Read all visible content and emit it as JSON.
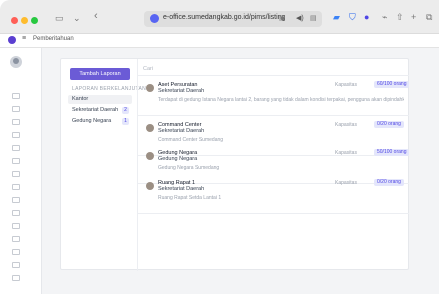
{
  "browser": {
    "url": "e-office.sumedangkab.go.id/pims/listing"
  },
  "tabbar": {
    "label": "Pemberitahuan"
  },
  "sidebar": {
    "compose_label": "Tambah Laporan",
    "section_label": "LAPORAN BERKELANJUTAN",
    "folders": [
      {
        "label": "Kantor",
        "count": ""
      },
      {
        "label": "Sekretariat Daerah",
        "count": "2"
      },
      {
        "label": "Gedung Negara",
        "count": "1"
      }
    ]
  },
  "search": {
    "placeholder": "Cari"
  },
  "mails": [
    {
      "sender": "Aset Persuratan",
      "org": "Sekretariat Daerah",
      "snippet": "Terdapat di gedung Istana Negara lantai 2, barang yang tidak dalam kondisi terpakai, pengguna akan dipindahkan ke ma",
      "status": "Kapasitas",
      "badge": "60/100 orang"
    },
    {
      "sender": "Command Center",
      "org": "Sekretariat Daerah",
      "snippet": "Command Center Sumedang",
      "status": "Kapasitas",
      "badge": "0/20 orang"
    },
    {
      "sender": "Gedung Negara",
      "org": "Gedung Negara",
      "snippet": "Gedung Negara Sumedang",
      "status": "Kapasitas",
      "badge": "50/100 orang"
    },
    {
      "sender": "Ruang Rapat 1",
      "org": "Sekretariat Daerah",
      "snippet": "Ruang Rapat Setda Lantai 1",
      "status": "Kapasitas",
      "badge": "0/20 orang"
    }
  ]
}
